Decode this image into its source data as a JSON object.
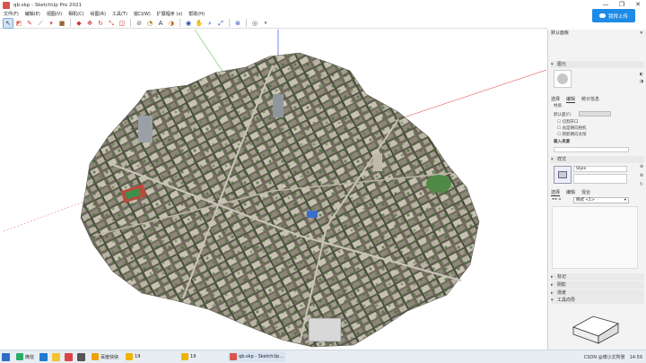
{
  "window": {
    "title": "qb.skp - SketchUp Pro 2021",
    "controls": [
      "—",
      "❐",
      "✕"
    ]
  },
  "menu": [
    "文件(F)",
    "编辑(E)",
    "视图(V)",
    "相机(C)",
    "绘图(R)",
    "工具(T)",
    "窗口(W)",
    "扩展程序 (x)",
    "帮助(H)"
  ],
  "upload": {
    "label": "我得上传"
  },
  "toolbar": {
    "tools": [
      "select-icon",
      "eraser-icon",
      "pencil-icon",
      "line-icon",
      "shape-icon",
      "paint-icon",
      "pushpull-icon",
      "move-icon",
      "rotate-icon",
      "scale-icon",
      "offset-icon",
      "tape-icon",
      "protractor-icon",
      "text-icon",
      "section-icon",
      "orbit-icon",
      "pan-icon",
      "zoom-icon",
      "zoom-extents-icon",
      "account-icon"
    ]
  },
  "tray": {
    "title": "默认面板",
    "entity_panel": {
      "header": "图元",
      "tabs": [
        "选择",
        "编辑",
        "统计信息"
      ],
      "name_label": "材质",
      "layer_label": "默认面(F)",
      "check1": "切割开口",
      "check2": "总是朝向相机",
      "check3": "阴影朝向太阳",
      "load_label": "载入来源"
    },
    "styles_panel": {
      "header": "样式",
      "style_name": "Style",
      "tabs": [
        "选择",
        "编辑",
        "混合"
      ],
      "dropdown": "样式 <1>"
    },
    "collapsed_panels": [
      "标记",
      "阴影",
      "场景",
      "工具向导"
    ]
  },
  "taskbar": {
    "items": [
      {
        "label": "微信",
        "color": "#2aae67"
      },
      {
        "label": "百度快快",
        "color": "#f0a000"
      },
      {
        "label": "19",
        "color": "#f0b400"
      },
      {
        "label": "19",
        "color": "#f0b400"
      },
      {
        "label": "qb.skp - SketchUp...",
        "color": "#d9534f"
      }
    ],
    "tray_text": "CSDN @博小文所景",
    "time": "14:59"
  },
  "colors": {
    "accent": "#1e8be6",
    "axis_red": "#e06060",
    "axis_green": "#60c060",
    "axis_blue": "#5566dd"
  }
}
